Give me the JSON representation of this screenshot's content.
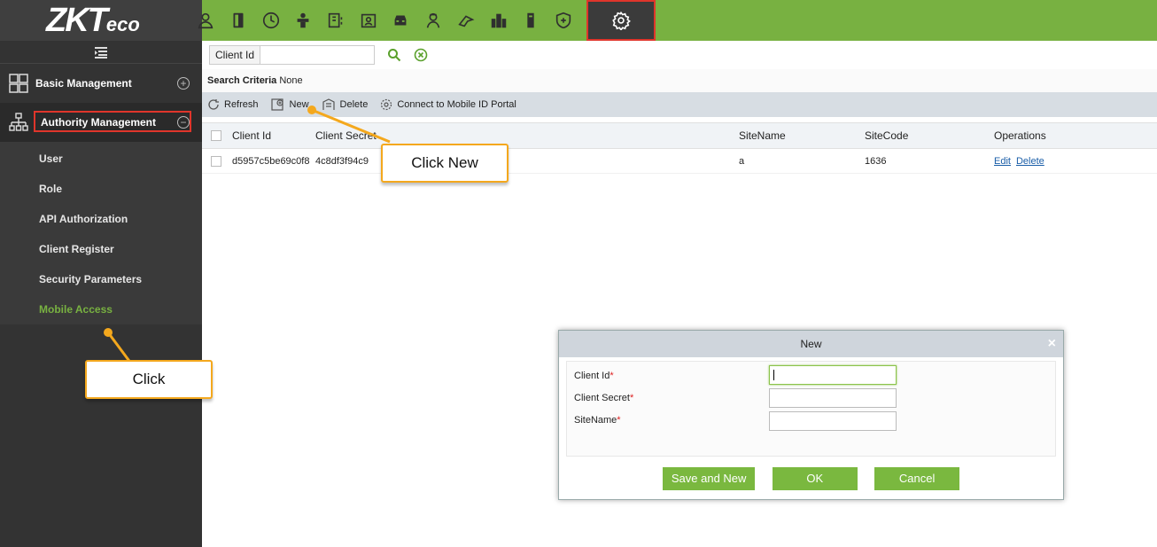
{
  "logo": {
    "main": "ZKT",
    "suffix": "eco"
  },
  "nav_icons": [
    "person-icon",
    "door-icon",
    "clock-icon",
    "elevator-icon",
    "visitor-icon",
    "badge-icon",
    "car-icon",
    "guard-icon",
    "patrol-icon",
    "building-icon",
    "tower-icon",
    "shield-plus-icon",
    "gear-icon"
  ],
  "sidebar": {
    "basic": "Basic Management",
    "authority": "Authority Management",
    "items": [
      "User",
      "Role",
      "API Authorization",
      "Client Register",
      "Security Parameters",
      "Mobile Access"
    ]
  },
  "search": {
    "label": "Client Id",
    "criteria_label": "Search Criteria",
    "criteria_value": "None"
  },
  "toolbar": {
    "refresh": "Refresh",
    "new": "New",
    "delete": "Delete",
    "connect": "Connect to Mobile ID Portal"
  },
  "table": {
    "headers": [
      "Client Id",
      "Client Secret",
      "SiteName",
      "SiteCode",
      "Operations"
    ],
    "rows": [
      {
        "client_id": "d5957c5be69c0f8",
        "client_secret": "4c8df3f94c9",
        "site_name": "a",
        "site_code": "1636",
        "edit": "Edit",
        "delete": "Delete"
      }
    ]
  },
  "dialog": {
    "title": "New",
    "close": "×",
    "fields": [
      "Client Id",
      "Client Secret",
      "SiteName"
    ],
    "required_mark": "*",
    "buttons": {
      "save_new": "Save and New",
      "ok": "OK",
      "cancel": "Cancel"
    }
  },
  "callouts": {
    "new": "Click New",
    "click": "Click"
  },
  "colors": {
    "brand_green": "#78b141",
    "highlight_red": "#e0352b",
    "callout_orange": "#f4a81d"
  }
}
